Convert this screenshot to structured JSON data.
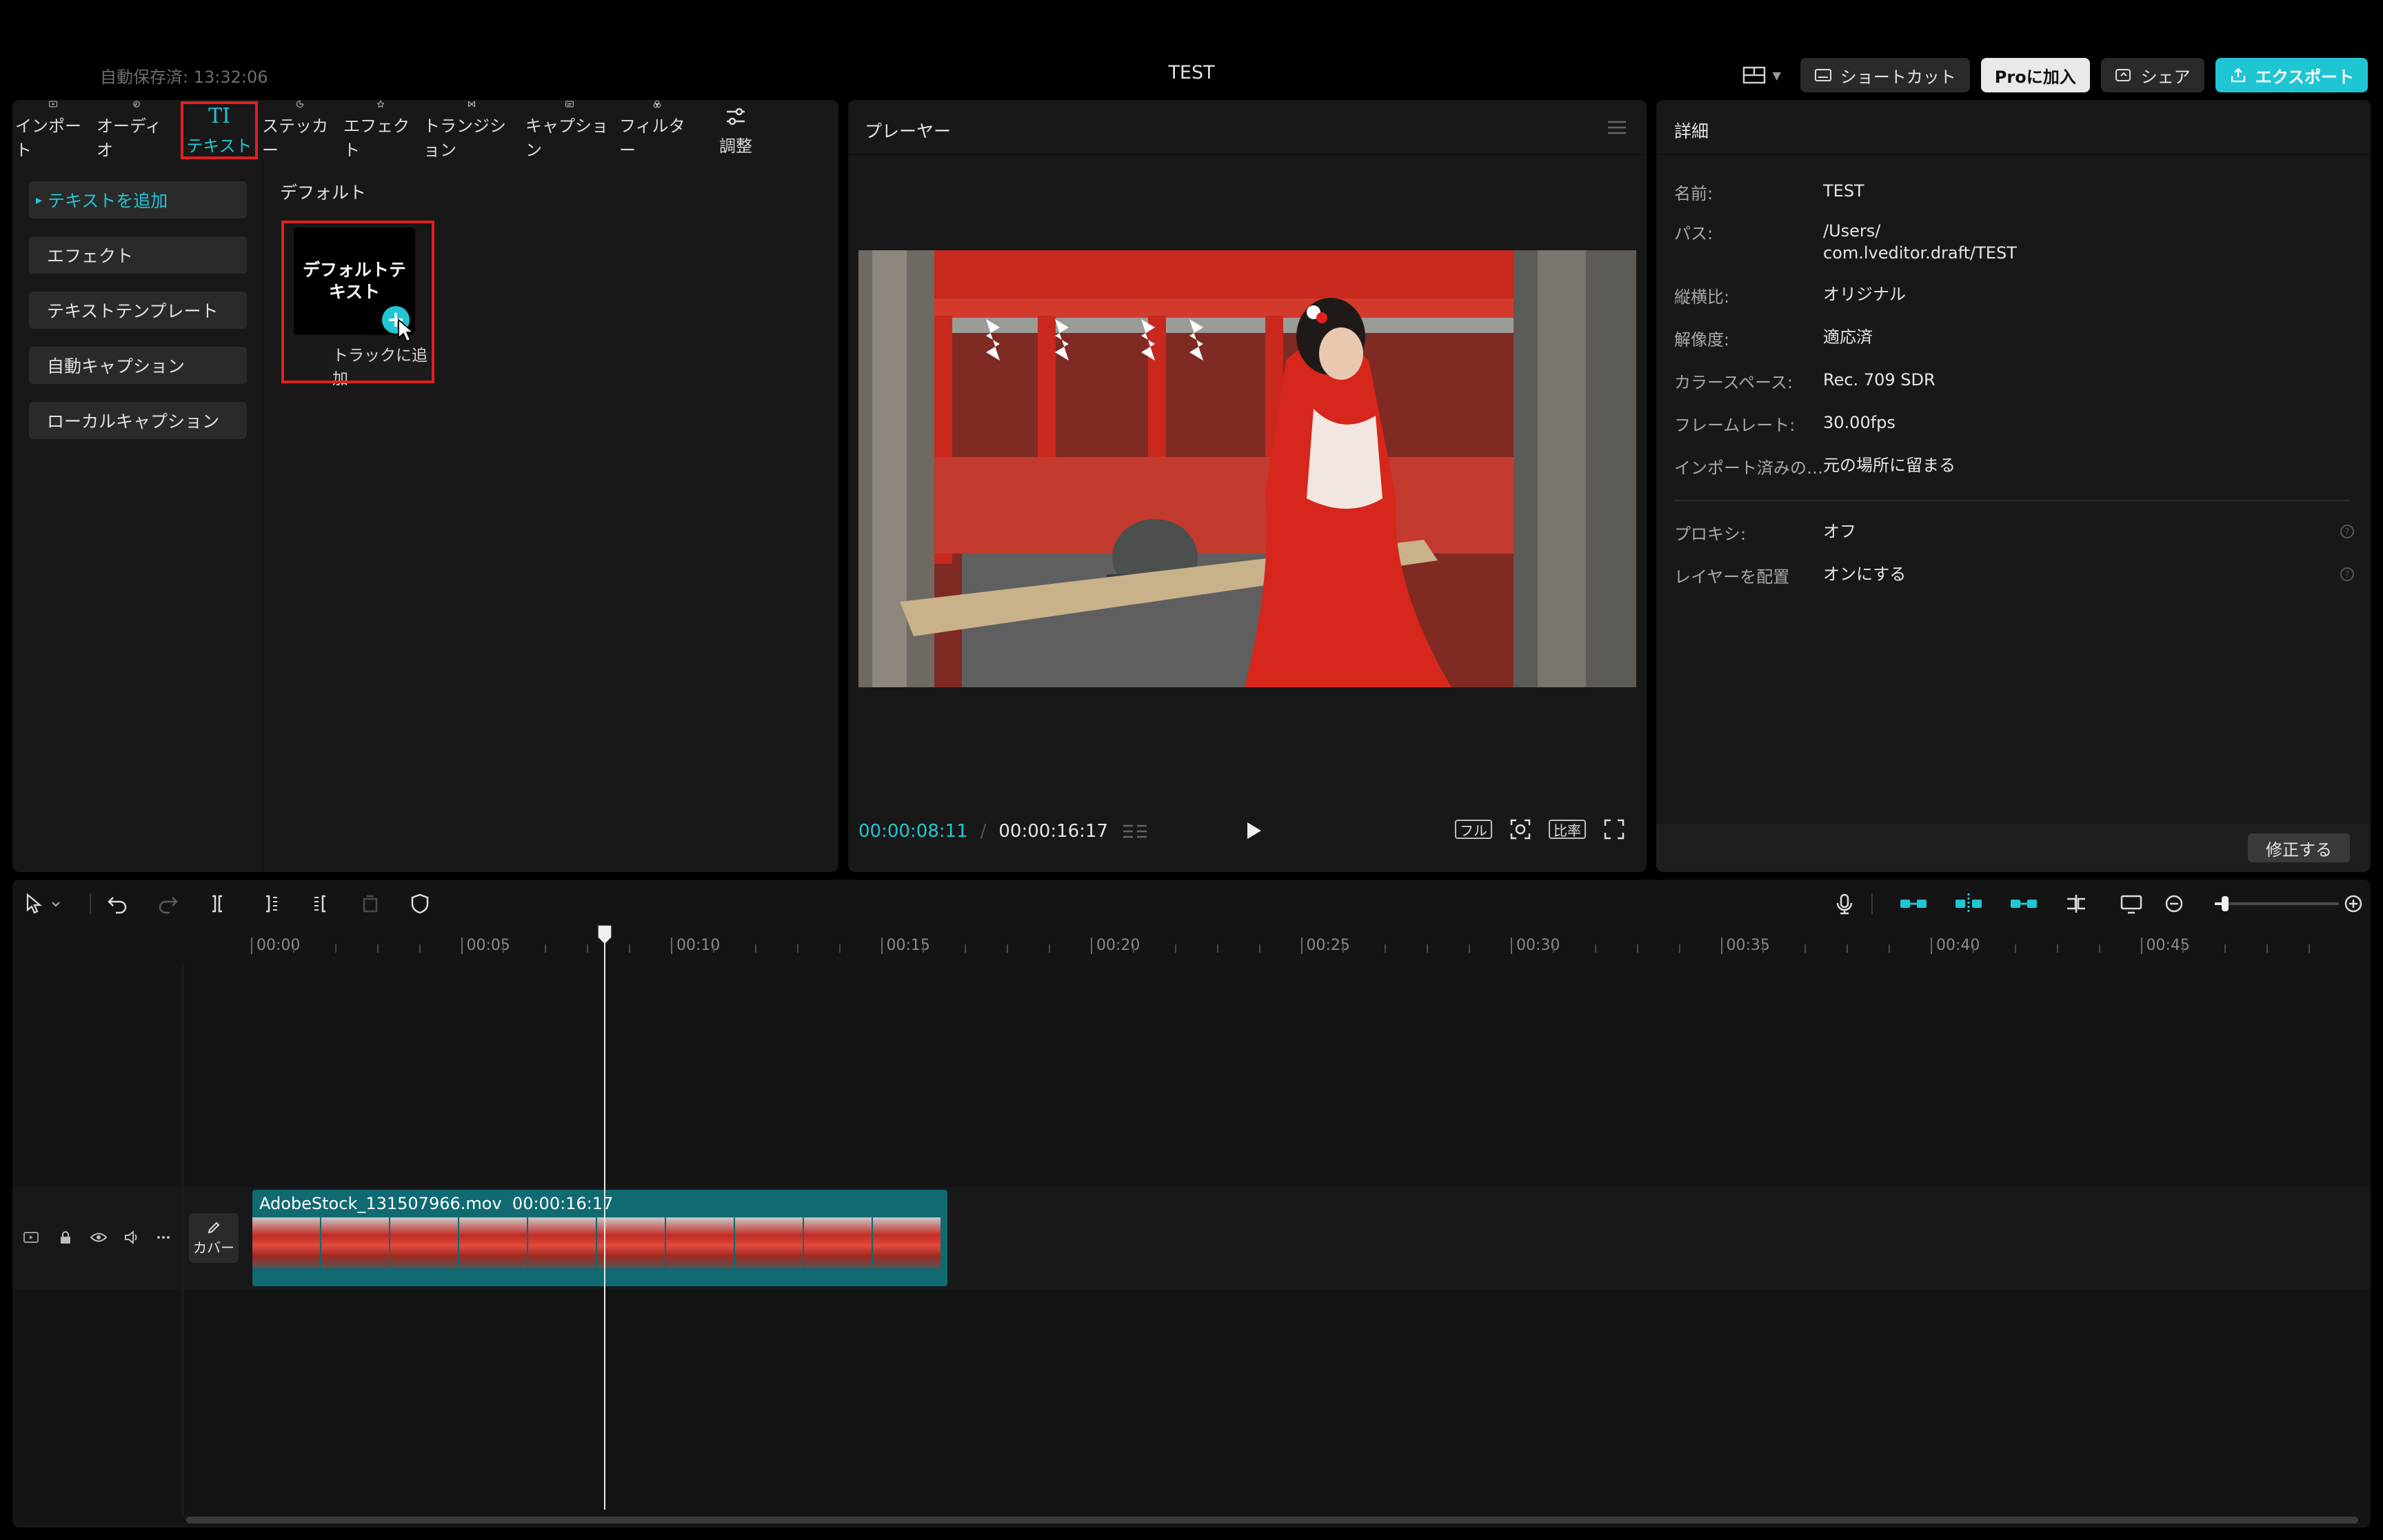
{
  "titlebar": {
    "autosave": "自動保存済: 13:32:06",
    "title": "TEST",
    "shortcut_label": "ショートカット",
    "pro_label": "Proに加入",
    "share_label": "シェア",
    "export_label": "エクスポート"
  },
  "media_tabs": [
    {
      "label": "インポート",
      "icon": "import-icon"
    },
    {
      "label": "オーディオ",
      "icon": "audio-icon"
    },
    {
      "label": "テキスト",
      "icon": "text-icon",
      "glyph": "TI"
    },
    {
      "label": "ステッカー",
      "icon": "sticker-icon"
    },
    {
      "label": "エフェクト",
      "icon": "effect-icon"
    },
    {
      "label": "トランジション",
      "icon": "transition-icon"
    },
    {
      "label": "キャプション",
      "icon": "caption-icon"
    },
    {
      "label": "フィルター",
      "icon": "filter-icon"
    },
    {
      "label": "調整",
      "icon": "adjust-icon"
    }
  ],
  "text_sidebar": [
    {
      "label": "テキストを追加",
      "active": true
    },
    {
      "label": "エフェクト"
    },
    {
      "label": "テキストテンプレート"
    },
    {
      "label": "自動キャプション"
    },
    {
      "label": "ローカルキャプション"
    }
  ],
  "text_content": {
    "section_label": "デフォルト",
    "card_text": "デフォルトテキスト",
    "add_glyph": "+",
    "tooltip": "トラックに追加"
  },
  "player": {
    "title": "プレーヤー",
    "current_time": "00:00:08:11",
    "separator": "/",
    "total_time": "00:00:16:17",
    "full_label": "フル",
    "ratio_label": "比率"
  },
  "details": {
    "title": "詳細",
    "rows": [
      {
        "key": "名前:",
        "value": [
          "TEST"
        ]
      },
      {
        "key": "パス:",
        "value": [
          "/Users/",
          "com.lveditor.draft/TEST"
        ]
      },
      {
        "key": "縦横比:",
        "value": [
          "オリジナル"
        ]
      },
      {
        "key": "解像度:",
        "value": [
          "適応済"
        ]
      },
      {
        "key": "カラースペース:",
        "value": [
          "Rec. 709 SDR"
        ]
      },
      {
        "key": "フレームレート:",
        "value": [
          "30.00fps"
        ]
      },
      {
        "key": "インポート済みの…",
        "value": [
          "元の場所に留まる"
        ]
      },
      {
        "key": "プロキシ:",
        "value": [
          "オフ"
        ]
      },
      {
        "key": "レイヤーを配置",
        "value": [
          "オンにする"
        ]
      }
    ],
    "modify_label": "修正する"
  },
  "timeline": {
    "ruler": [
      "00:00",
      "00:05",
      "00:10",
      "00:15",
      "00:20",
      "00:25",
      "00:30",
      "00:35",
      "00:40",
      "00:45"
    ],
    "cover_label": "カバー",
    "clip_name": "AdobeStock_131507966.mov",
    "clip_duration": "00:00:16:17",
    "zoom_level": 0.1
  },
  "colors": {
    "accent": "#21c6d3",
    "highlight": "#e02020",
    "clip": "#0f6a72"
  }
}
